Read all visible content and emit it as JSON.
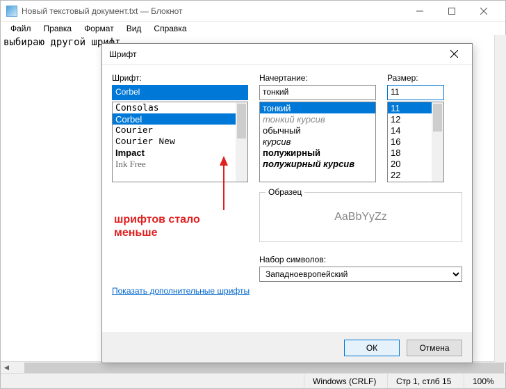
{
  "window": {
    "title": "Новый текстовый документ.txt — Блокнот"
  },
  "menu": {
    "file": "Файл",
    "edit": "Правка",
    "format": "Формат",
    "view": "Вид",
    "help": "Справка"
  },
  "editor": {
    "text": "выбираю другой шрифт"
  },
  "status": {
    "encoding_mode": "Windows (CRLF)",
    "caret": "Стр 1, стлб 15",
    "zoom": "100%"
  },
  "dialog": {
    "title": "Шрифт",
    "font_label": "Шрифт:",
    "font_value": "Corbel",
    "font_list": [
      "Consolas",
      "Corbel",
      "Courier",
      "Courier New",
      "Impact",
      "Ink Free"
    ],
    "style_label": "Начертание:",
    "style_value": "тонкий",
    "style_list": [
      "тонкий",
      "тонкий курсив",
      "обычный",
      "курсив",
      "полужирный",
      "полужирный курсив"
    ],
    "size_label": "Размер:",
    "size_value": "11",
    "size_list": [
      "11",
      "12",
      "14",
      "16",
      "18",
      "20",
      "22"
    ],
    "sample_label": "Образец",
    "sample_text": "AaBbYyZz",
    "script_label": "Набор символов:",
    "script_value": "Западноевропейский",
    "link": "Показать дополнительные шрифты",
    "ok": "ОК",
    "cancel": "Отмена"
  },
  "annotation": {
    "text": "шрифтов стало\nменьше"
  }
}
